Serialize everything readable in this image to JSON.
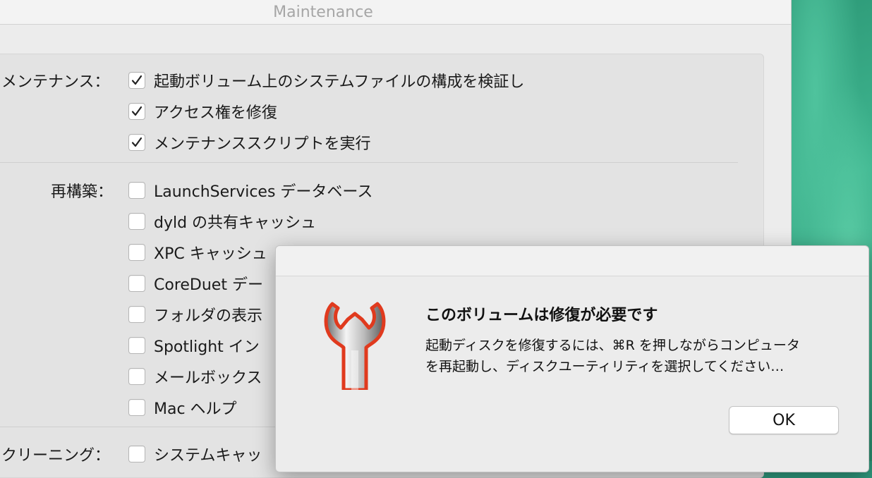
{
  "window": {
    "title": "Maintenance"
  },
  "maintenance": {
    "label": "メンテナンス：",
    "items": [
      {
        "label": "起動ボリューム上のシステムファイルの構成を検証し",
        "checked": true
      },
      {
        "label": "アクセス権を修復",
        "checked": true
      },
      {
        "label": "メンテナンススクリプトを実行",
        "checked": true
      }
    ]
  },
  "rebuild": {
    "label": "再構築：",
    "items": [
      {
        "label": "LaunchServices データベース",
        "checked": false
      },
      {
        "label": "dyld の共有キャッシュ",
        "checked": false
      },
      {
        "label": "XPC キャッシュ",
        "checked": false
      },
      {
        "label": "CoreDuet デー",
        "checked": false
      },
      {
        "label": "フォルダの表示",
        "checked": false
      },
      {
        "label": "Spotlight イン",
        "checked": false
      },
      {
        "label": "メールボックス",
        "checked": false
      },
      {
        "label": "Mac ヘルプ",
        "checked": false
      }
    ]
  },
  "cleaning": {
    "label": "クリーニング：",
    "items": [
      {
        "label": "システムキャッ",
        "checked": false
      }
    ]
  },
  "alert": {
    "title": "このボリュームは修復が必要です",
    "message_line1": "起動ディスクを修復するには、⌘R を押しながらコンピュータ",
    "message_line2": "を再起動し、ディスクユーティリティを選択してください…",
    "ok_label": "OK",
    "icon": "wrench-icon"
  },
  "colors": {
    "wallpaper": "#2f9a7e",
    "window_bg": "#ececec",
    "wrench_red": "#e03a1e"
  }
}
